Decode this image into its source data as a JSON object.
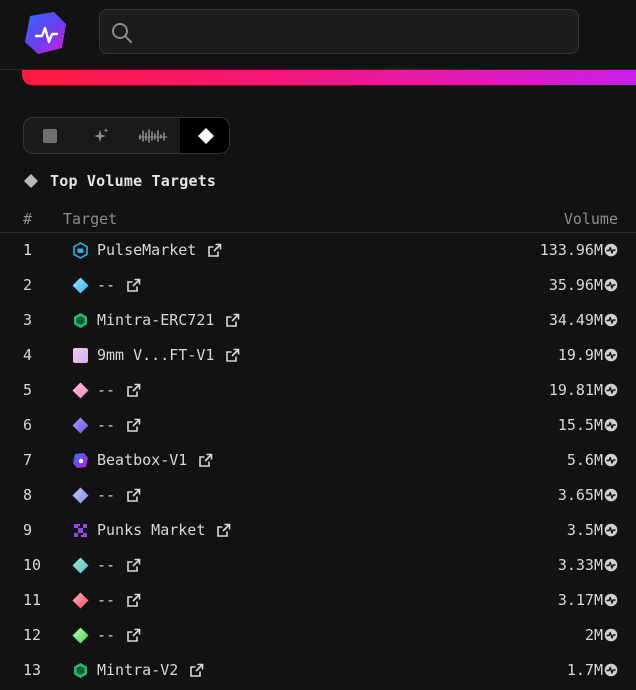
{
  "header": {
    "search": {
      "placeholder": "",
      "value": ""
    }
  },
  "colors": {
    "accent_start": "#ff1a3c",
    "accent_mid": "#f01880",
    "accent_end": "#c91ee8",
    "background": "#121212"
  },
  "view_toggle": {
    "options": [
      {
        "icon": "square-icon",
        "active": false
      },
      {
        "icon": "sparkle-icon",
        "active": false
      },
      {
        "icon": "wave-icon",
        "active": false
      },
      {
        "icon": "diamond-icon",
        "active": true
      }
    ]
  },
  "section": {
    "title": "Top Volume Targets"
  },
  "table": {
    "headers": {
      "rank": "#",
      "target": "Target",
      "volume": "Volume"
    },
    "rows": [
      {
        "rank": "1",
        "name": "PulseMarket",
        "icon": "pulsemarket-icon",
        "volume": "133.96M"
      },
      {
        "rank": "2",
        "name": "--",
        "icon": "diamond-cyan-icon",
        "volume": "35.96M"
      },
      {
        "rank": "3",
        "name": "Mintra-ERC721",
        "icon": "mintra-icon",
        "volume": "34.49M"
      },
      {
        "rank": "4",
        "name": "9mm V...FT-V1",
        "icon": "9mm-icon",
        "volume": "19.9M"
      },
      {
        "rank": "5",
        "name": "--",
        "icon": "diamond-pink-icon",
        "volume": "19.81M"
      },
      {
        "rank": "6",
        "name": "--",
        "icon": "diamond-purple-icon",
        "volume": "15.5M"
      },
      {
        "rank": "7",
        "name": "Beatbox-V1",
        "icon": "beatbox-icon",
        "volume": "5.6M"
      },
      {
        "rank": "8",
        "name": "--",
        "icon": "diamond-lavender-icon",
        "volume": "3.65M"
      },
      {
        "rank": "9",
        "name": "Punks Market",
        "icon": "punks-market-icon",
        "volume": "3.5M"
      },
      {
        "rank": "10",
        "name": "--",
        "icon": "diamond-teal-icon",
        "volume": "3.33M"
      },
      {
        "rank": "11",
        "name": "--",
        "icon": "diamond-red-icon",
        "volume": "3.17M"
      },
      {
        "rank": "12",
        "name": "--",
        "icon": "diamond-green-icon",
        "volume": "2M"
      },
      {
        "rank": "13",
        "name": "Mintra-V2",
        "icon": "mintra-icon",
        "volume": "1.7M"
      }
    ]
  }
}
